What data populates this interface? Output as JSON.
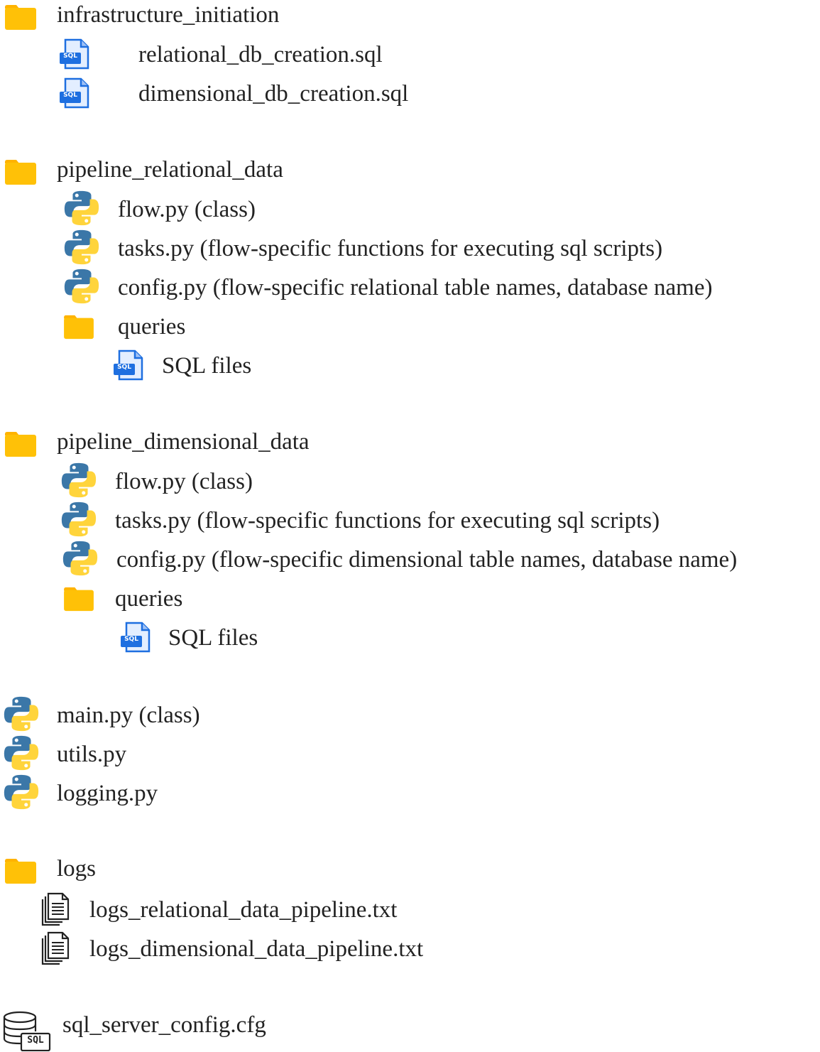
{
  "tree": {
    "infrastructure": {
      "folder": "infrastructure_initiation",
      "files": [
        "relational_db_creation.sql",
        "dimensional_db_creation.sql"
      ]
    },
    "pipeline_relational": {
      "folder": "pipeline_relational_data",
      "flow": "flow.py (class)",
      "tasks": "tasks.py (flow-specific functions for executing sql scripts)",
      "config": "config.py (flow-specific relational table names, database name)",
      "queries": "queries",
      "sql_files": "SQL files"
    },
    "pipeline_dimensional": {
      "folder": "pipeline_dimensional_data",
      "flow": "flow.py (class)",
      "tasks": "tasks.py (flow-specific functions for executing sql scripts)",
      "config": "config.py (flow-specific dimensional table names, database name)",
      "queries": "queries",
      "sql_files": "SQL files"
    },
    "root_py": [
      "main.py (class)",
      "utils.py",
      "logging.py"
    ],
    "logs": {
      "folder": "logs",
      "files": [
        "logs_relational_data_pipeline.txt",
        "logs_dimensional_data_pipeline.txt"
      ]
    },
    "sql_config": "sql_server_config.cfg"
  },
  "icons": {
    "folder": "folder-icon",
    "sql_file": "sql-file-icon",
    "python": "python-icon",
    "text_file": "text-file-icon",
    "database": "database-icon"
  },
  "icon_text": {
    "sql": "SQL"
  },
  "colors": {
    "folder": "#FFC107",
    "folder_tab": "#FFB300",
    "sql_blue": "#1E6FE0",
    "python_blue": "#3B77A8",
    "python_yellow": "#FFD43B"
  }
}
